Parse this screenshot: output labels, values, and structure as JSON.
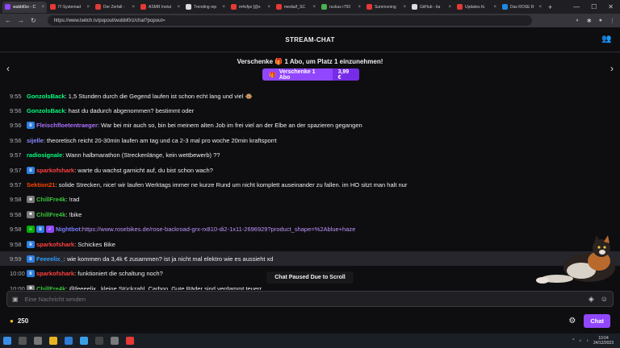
{
  "browser": {
    "tabs": [
      {
        "label": "wubbl0rz - C",
        "color": "#9147ff"
      },
      {
        "label": "IT-Systemad",
        "color": "#e53935"
      },
      {
        "label": "Der Zerfall -",
        "color": "#e53935"
      },
      {
        "label": "ASMR Instut",
        "color": "#e53935"
      },
      {
        "label": "Trending rep",
        "color": "#dddddd"
      },
      {
        "label": "m4vfpx [@s",
        "color": "#e53935"
      },
      {
        "label": "media/f_SC",
        "color": "#e53935"
      },
      {
        "label": "ruckus r750",
        "color": "#4caf50"
      },
      {
        "label": "Summoning",
        "color": "#e53935"
      },
      {
        "label": "GitHub - tia",
        "color": "#dddddd"
      },
      {
        "label": "Updates fü",
        "color": "#e53935"
      },
      {
        "label": "Das ROSE R",
        "color": "#1e88e5"
      }
    ],
    "url": "https://www.twitch.tv/popout/wubbl0rz/chat?popout="
  },
  "header": {
    "title": "STREAM-CHAT"
  },
  "gift": {
    "title": "Verschenke 🎁 1 Abo, um Platz 1 einzunehmen!",
    "button_label": "Verschenke 1 Abo",
    "price": "3,99 €"
  },
  "messages": [
    {
      "time": "9:55",
      "user": "GonzolsBack",
      "color": "#00ff7f",
      "badges": [],
      "text": ": 1,5 Stunden durch die Gegend laufen ist schon echt lang und viel 🐵",
      "link": ""
    },
    {
      "time": "9:56",
      "user": "GonzolsBack",
      "color": "#00ff7f",
      "badges": [],
      "text": ": hast du dadurch abgenommen? bestimmt oder",
      "link": ""
    },
    {
      "time": "9:56",
      "user": "Fleischfloetentraeger",
      "color": "#a970ff",
      "badges": [
        "sub"
      ],
      "text": ": War bei mir auch so, bin bei meinem alten Job im frei viel an der Elbe an der spazieren gegangen",
      "link": ""
    },
    {
      "time": "9:56",
      "user": "sijelle",
      "color": "#8a8aff",
      "badges": [],
      "text": ": theoretisch reicht 20-30min laufen am tag und ca 2-3 mal pro woche 20min kraftsporrt",
      "link": ""
    },
    {
      "time": "9:57",
      "user": "radiosignale",
      "color": "#00ff7f",
      "badges": [],
      "text": ": Wann halbmarathon (Streckenlänge, kein wettbewerb) ??",
      "link": ""
    },
    {
      "time": "9:57",
      "user": "sparkofshark",
      "color": "#ff4040",
      "badges": [
        "sub"
      ],
      "text": ": warte du wachst garnicht auf, du bist schon wach?",
      "link": ""
    },
    {
      "time": "9:57",
      "user": "Sektion21",
      "color": "#ff4500",
      "badges": [],
      "text": ": solide Strecken, nice! wir laufen Werktags immer ne kurze Rund um nicht komplett auseinander zu fallen. im HO sitzt man halt nur",
      "link": ""
    },
    {
      "time": "9:58",
      "user": "ChillFre4k",
      "color": "#3ac43a",
      "badges": [
        "emote"
      ],
      "text": ": !rad",
      "link": ""
    },
    {
      "time": "9:58",
      "user": "ChillFre4k",
      "color": "#3ac43a",
      "badges": [
        "emote"
      ],
      "text": ": !bike",
      "link": ""
    },
    {
      "time": "9:58",
      "user": "Nightbot",
      "color": "#7c7cff",
      "badges": [
        "mod",
        "sub",
        "verified"
      ],
      "text": ": ",
      "link": "https://www.rosebikes.de/rose-backroad-grx-rx810-di2-1x11-2696929?product_shape=%2Ablue+haze"
    },
    {
      "time": "9:58",
      "user": "sparkofshark",
      "color": "#ff4040",
      "badges": [
        "sub"
      ],
      "text": ": Schickes Bike",
      "link": ""
    },
    {
      "time": "9:59",
      "user": "Feeeelix_",
      "color": "#2e9cff",
      "badges": [
        "sub"
      ],
      "text": ": wie kommen da 3,4k € zusammen? ist ja nicht mal elektro wie es aussieht xd",
      "link": ""
    },
    {
      "time": "10:00",
      "user": "sparkofshark",
      "color": "#ff4040",
      "badges": [
        "sub"
      ],
      "text": ": funktioniert die schaltung noch?",
      "link": ""
    },
    {
      "time": "10:00",
      "user": "ChillFre4k",
      "color": "#3ac43a",
      "badges": [
        "emote"
      ],
      "text": ": @feeeelix_ kleine Stückzahl, Carbon, Gute Räder sind verdammt teuerr",
      "link": ""
    }
  ],
  "paused_label": "Chat Paused Due to Scroll",
  "input": {
    "placeholder": "Eine Nachricht senden"
  },
  "footer": {
    "points": "250",
    "chat_button": "Chat"
  },
  "taskbar": {
    "time": "10:04",
    "date": "24/12/2023"
  }
}
